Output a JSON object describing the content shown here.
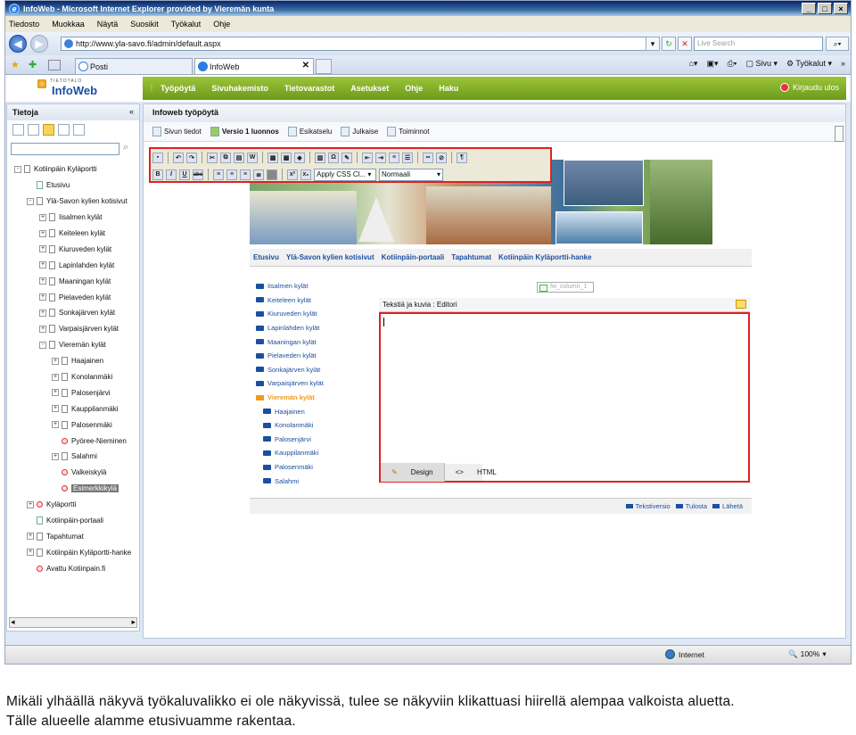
{
  "window": {
    "title": "InfoWeb - Microsoft Internet Explorer provided by Vieremän kunta",
    "buttons": [
      "_",
      "□",
      "×"
    ]
  },
  "menu": [
    "Tiedosto",
    "Muokkaa",
    "Näytä",
    "Suosikit",
    "Työkalut",
    "Ohje"
  ],
  "address": {
    "url": "http://www.yla-savo.fi/admin/default.aspx",
    "search_placeholder": "Live Search"
  },
  "tabs": [
    {
      "label": "Posti"
    },
    {
      "label": "InfoWeb"
    }
  ],
  "commandbar": [
    "Sivu",
    "Työkalut"
  ],
  "app": {
    "logo_top": "TIETOTALO",
    "logo": "InfoWeb",
    "nav": [
      "Työpöytä",
      "Sivuhakemisto",
      "Tietovarastot",
      "Asetukset",
      "Ohje",
      "Haku"
    ],
    "logout": "Kirjaudu ulos"
  },
  "left": {
    "title": "Tietoja",
    "collapse": "«",
    "tree": [
      {
        "label": "Kotiinpäin Kyläportti",
        "indent": 0,
        "pm": "-",
        "icon": "page"
      },
      {
        "label": "Etusivu",
        "indent": 1,
        "pm": "",
        "icon": "home"
      },
      {
        "label": "Ylä-Savon kylien kotisivut",
        "indent": 1,
        "pm": "-",
        "icon": "page"
      },
      {
        "label": "Iisalmen kylät",
        "indent": 2,
        "pm": "+",
        "icon": "page"
      },
      {
        "label": "Keiteleen kylät",
        "indent": 2,
        "pm": "+",
        "icon": "page"
      },
      {
        "label": "Kiuruveden kylät",
        "indent": 2,
        "pm": "+",
        "icon": "page"
      },
      {
        "label": "Lapinlahden kylät",
        "indent": 2,
        "pm": "+",
        "icon": "page"
      },
      {
        "label": "Maaningan kylät",
        "indent": 2,
        "pm": "+",
        "icon": "page"
      },
      {
        "label": "Pielaveden kylät",
        "indent": 2,
        "pm": "+",
        "icon": "page"
      },
      {
        "label": "Sonkajärven kylät",
        "indent": 2,
        "pm": "+",
        "icon": "page"
      },
      {
        "label": "Varpaisjärven kylät",
        "indent": 2,
        "pm": "+",
        "icon": "page"
      },
      {
        "label": "Vieremän kylät",
        "indent": 2,
        "pm": "-",
        "icon": "page"
      },
      {
        "label": "Haajainen",
        "indent": 3,
        "pm": "+",
        "icon": "page"
      },
      {
        "label": "Konolanmäki",
        "indent": 3,
        "pm": "+",
        "icon": "page"
      },
      {
        "label": "Palosenjärvi",
        "indent": 3,
        "pm": "+",
        "icon": "page"
      },
      {
        "label": "Kauppilanmäki",
        "indent": 3,
        "pm": "+",
        "icon": "page"
      },
      {
        "label": "Palosenmäki",
        "indent": 3,
        "pm": "+",
        "icon": "page"
      },
      {
        "label": "Pyöree-Nieminen",
        "indent": 3,
        "pm": "",
        "icon": "red"
      },
      {
        "label": "Salahmi",
        "indent": 3,
        "pm": "+",
        "icon": "page"
      },
      {
        "label": "Valkeiskylä",
        "indent": 3,
        "pm": "",
        "icon": "red"
      },
      {
        "label": "Esimerkkikylä",
        "indent": 3,
        "pm": "",
        "icon": "red",
        "selected": true
      },
      {
        "label": "Kyläportti",
        "indent": 1,
        "pm": "+",
        "icon": "red"
      },
      {
        "label": "Kotiinpäin-portaali",
        "indent": 1,
        "pm": "",
        "icon": "home"
      },
      {
        "label": "Tapahtumat",
        "indent": 1,
        "pm": "+",
        "icon": "page"
      },
      {
        "label": "Kotiinpäin Kyläportti-hanke",
        "indent": 1,
        "pm": "+",
        "icon": "page"
      },
      {
        "label": "Avattu Kotiinpain.fi",
        "indent": 1,
        "pm": "",
        "icon": "red"
      }
    ]
  },
  "main": {
    "title": "Infoweb työpöytä",
    "toolbar": [
      "Sivun tiedot",
      "Versio 1 luonnos",
      "Esikatselu",
      "Julkaise",
      "Toiminnot"
    ],
    "editor": {
      "style_dropdown": "Apply CSS Cl...",
      "format_dropdown": "Normaali",
      "format_buttons": [
        "B",
        "I",
        "U",
        "abc",
        "x²",
        "x₂"
      ],
      "label": "Tekstiä ja kuvia : Editori",
      "column_box": "fw_column_1",
      "modes": [
        "Design",
        "HTML"
      ]
    },
    "site_nav": [
      "Etusivu",
      "Ylä-Savon kylien kotisivut",
      "Kotiinpäin-portaali",
      "Tapahtumat",
      "Kotiinpäin Kyläportti-hanke"
    ],
    "site_menu": [
      {
        "label": "Iisalmen kylät"
      },
      {
        "label": "Keiteleen kylät"
      },
      {
        "label": "Kiuruveden kylät"
      },
      {
        "label": "Lapinlahden kylät"
      },
      {
        "label": "Maaningan kylät"
      },
      {
        "label": "Pielaveden kylät"
      },
      {
        "label": "Sonkajärven kylät"
      },
      {
        "label": "Varpaisjärven kylät"
      },
      {
        "label": "Vieremän kylät",
        "active": true
      },
      {
        "label": "Haajainen",
        "sub": true
      },
      {
        "label": "Konolanmäki",
        "sub": true
      },
      {
        "label": "Palosenjärvi",
        "sub": true
      },
      {
        "label": "Kauppilanmäki",
        "sub": true
      },
      {
        "label": "Palosenmäki",
        "sub": true
      },
      {
        "label": "Salahmi",
        "sub": true
      }
    ],
    "footer_links": [
      "Tekstiversio",
      "Tulosta",
      "Lähetä"
    ]
  },
  "status": {
    "zone": "Internet",
    "zoom": "100%"
  },
  "caption": {
    "line1": "Mikäli ylhäällä näkyvä työkaluvalikko ei ole näkyvissä, tulee se näkyviin klikattuasi hiirellä alempaa valkoista aluetta.",
    "line2": "Tälle alueelle alamme etusivuamme rakentaa."
  }
}
